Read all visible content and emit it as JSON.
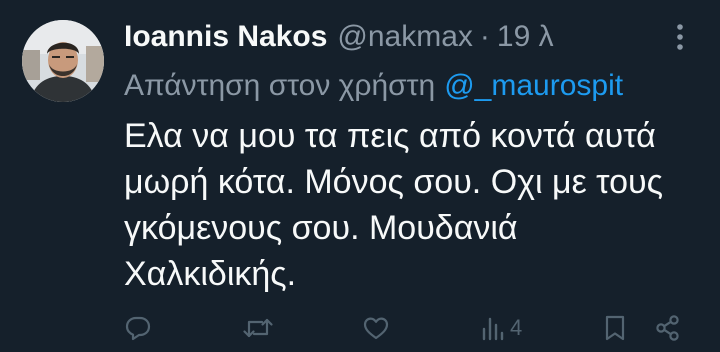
{
  "tweet": {
    "author": {
      "display_name": "Ioannis Nakos",
      "handle": "@nakmax",
      "separator": "·",
      "time": "19 λ"
    },
    "reply_to": {
      "prefix": "Απάντηση στον χρήστη",
      "mention": "@_maurospit"
    },
    "text": "Ελα να μου τα πεις από κοντά αυτά\nμωρή κότα. Μόνος σου. Οχι με τους\nγκόμενους σου. Μουδανιά\nΧαλκιδικής.",
    "actions": {
      "views": "4"
    }
  },
  "colors": {
    "background": "#15202b",
    "primary_text": "#f7f9f9",
    "secondary_text": "#8b98a5",
    "link": "#1d9bf0",
    "action_icon": "#536471"
  },
  "icons": [
    "more-icon",
    "reply-icon",
    "retweet-icon",
    "like-icon",
    "views-icon",
    "bookmark-icon",
    "share-icon"
  ]
}
